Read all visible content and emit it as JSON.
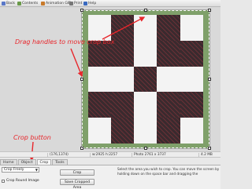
{
  "toolbar": {
    "items": [
      {
        "label": "Back",
        "icon": "back-icon",
        "color": "#5a78c8"
      },
      {
        "label": "Contents",
        "icon": "contents-icon",
        "color": "#6a9a4a"
      },
      {
        "label": "Animation GIF",
        "icon": "gif-icon",
        "color": "#c87a2a"
      },
      {
        "label": "Print",
        "icon": "print-icon",
        "color": "#777777"
      },
      {
        "label": "Help",
        "icon": "help-icon",
        "color": "#3a6ac0"
      }
    ]
  },
  "annotations": {
    "drag_handles": "Drag handles to move crop box",
    "crop_button": "Crop button",
    "color": "#e8262b"
  },
  "status": {
    "coords": "(176,1374)",
    "size": "w:2925 h:2257",
    "photo": "Photo 2761 x 3737",
    "memory": "4.2 MB"
  },
  "tabs": [
    "Home",
    "Object",
    "Crop",
    "Tools"
  ],
  "active_tab": "Crop",
  "options": {
    "mode_select": "Crop Freely",
    "round_image_label": "Crop Round Image",
    "crop_button": "Crop",
    "save_button": "Save Cropped Area",
    "help_text": "Select the area you wish to crop. You can move the screen by holding down on the space bar and dragging the"
  }
}
